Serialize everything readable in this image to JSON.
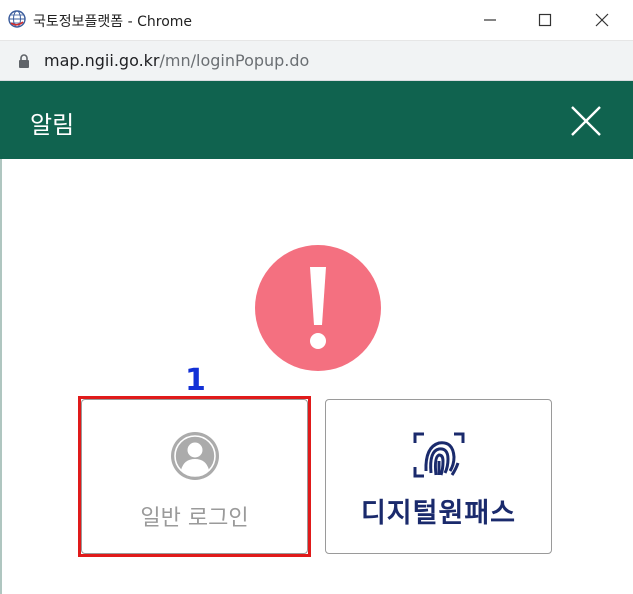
{
  "window": {
    "title": "국토정보플랫폼 - Chrome",
    "url_host": "map.ngii.go.kr",
    "url_path": "/mn/loginPopup.do"
  },
  "header": {
    "title": "알림"
  },
  "annotation": {
    "step": "1"
  },
  "login_options": {
    "general_label": "일반 로그인",
    "digital_label": "디지털원패스"
  },
  "icons": {
    "alert": "exclamation-circle-icon",
    "general": "person-icon",
    "digital": "fingerprint-icon"
  },
  "colors": {
    "header_bg": "#10634f",
    "alert_bg": "#f47080",
    "highlight": "#e01a1a",
    "step_number": "#1230d6",
    "digital_brand": "#1a2a6c"
  }
}
